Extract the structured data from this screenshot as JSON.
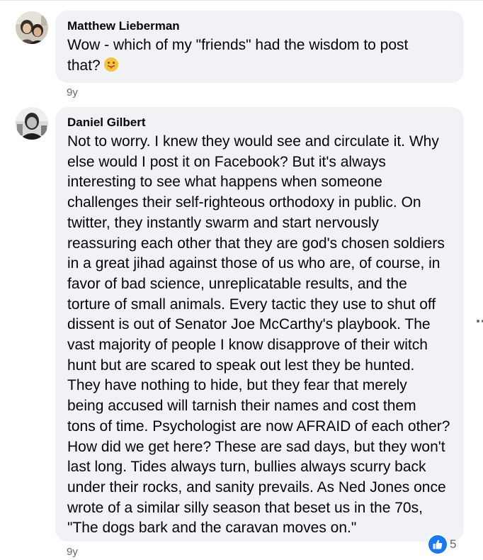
{
  "comments": [
    {
      "author": "Matthew Lieberman",
      "text": "Wow - which of my \"friends\" had the wisdom to post\nthat?",
      "emoji": "tongue-out-emoji",
      "time": "9y"
    },
    {
      "author": "Daniel Gilbert",
      "text": "Not to worry. I knew they would see and circulate it. Why\nelse would I post it on Facebook? But it's always\ninteresting to see what happens when someone\nchallenges their self-righteous orthodoxy in public. On\ntwitter, they instantly swarm and start nervously\nreassuring each other that they are god's chosen soldiers\nin a great jihad against those of us who are, of course, in\nfavor of bad science, unreplicatable results, and the\ntorture of small animals. Every tactic they use to shut off\ndissent is out of Senator Joe McCarthy's playbook. The\nvast majority of people I know disapprove of their witch\nhunt but are scared to speak out lest they be hunted.\nThey have nothing to hide, but they fear that merely\nbeing accused will tarnish their names and cost them\ntons of time. Psychologist are now AFRAID of each other?\nHow did we get here? These are sad days, but they won't\nlast long. Tides always turn, bullies always scurry back\nunder their rocks, and sanity prevails. As Ned Jones once\nwrote of a similar silly season that beset us in the 70s,\n\"The dogs bark and the caravan moves on.\"",
      "time": "9y",
      "reaction_icon": "like-icon",
      "reaction_count": "5"
    }
  ],
  "colors": {
    "bubble": "#f0f2f5",
    "meta_text": "#65676b",
    "like_blue": "#1877f2"
  }
}
